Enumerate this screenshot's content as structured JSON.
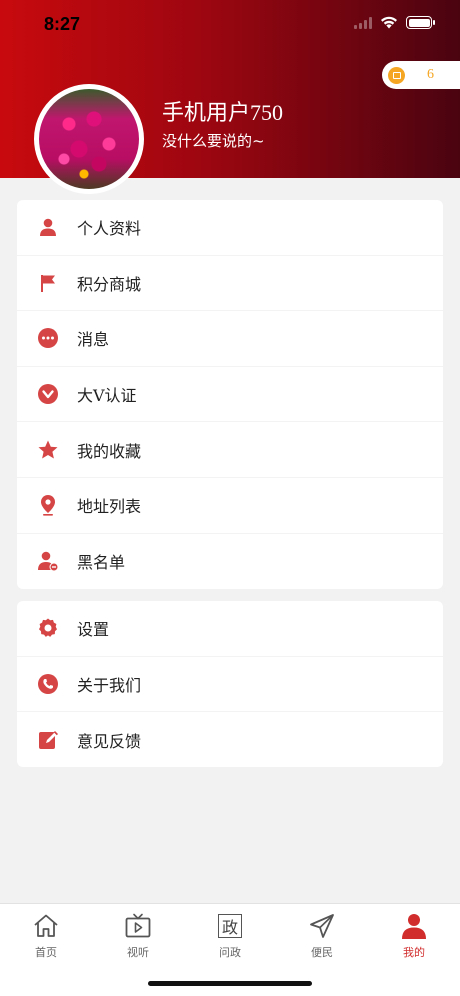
{
  "status_bar": {
    "time": "8:27"
  },
  "header": {
    "username": "手机用户750",
    "signature": "没什么要说的~",
    "points": "6"
  },
  "menu_group_1": [
    {
      "label": "个人资料",
      "icon": "person-icon"
    },
    {
      "label": "积分商城",
      "icon": "flag-icon"
    },
    {
      "label": "消息",
      "icon": "chat-icon"
    },
    {
      "label": "大V认证",
      "icon": "v-badge-icon"
    },
    {
      "label": "我的收藏",
      "icon": "star-icon"
    },
    {
      "label": "地址列表",
      "icon": "location-pin-icon"
    },
    {
      "label": "黑名单",
      "icon": "user-block-icon"
    }
  ],
  "menu_group_2": [
    {
      "label": "设置",
      "icon": "gear-icon"
    },
    {
      "label": "关于我们",
      "icon": "phone-icon"
    },
    {
      "label": "意见反馈",
      "icon": "edit-icon"
    }
  ],
  "tabbar": [
    {
      "label": "首页",
      "icon": "home-icon"
    },
    {
      "label": "视听",
      "icon": "tv-play-icon"
    },
    {
      "label": "问政",
      "icon": "zheng-icon",
      "glyph": "政"
    },
    {
      "label": "便民",
      "icon": "send-icon"
    },
    {
      "label": "我的",
      "icon": "user-filled-icon",
      "active": true
    }
  ],
  "colors": {
    "accent": "#d12d2d",
    "icon_red": "#d64545",
    "coin": "#f5a623"
  }
}
